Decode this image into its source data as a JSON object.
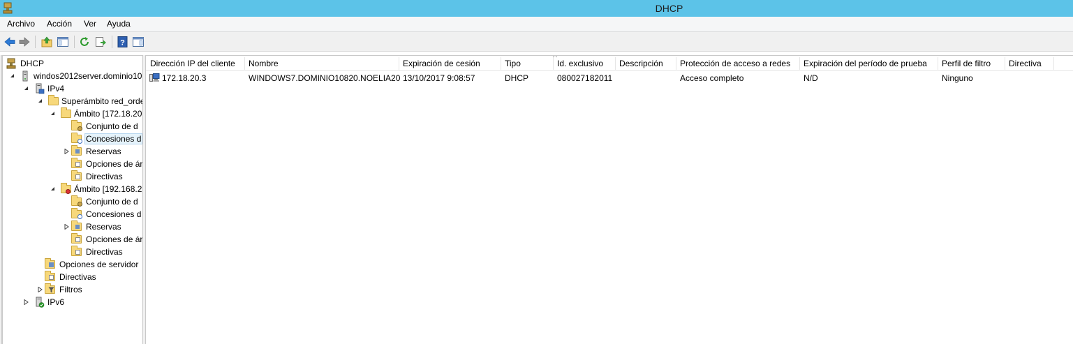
{
  "window": {
    "title": "DHCP",
    "accent": "#5cc3e8"
  },
  "menu": [
    "Archivo",
    "Acción",
    "Ver",
    "Ayuda"
  ],
  "toolbar": {
    "buttons": [
      "back-icon",
      "forward-icon",
      "up-folder-icon",
      "show-hide-tree-icon",
      "refresh-icon",
      "export-list-icon",
      "help-icon",
      "show-action-pane-icon"
    ]
  },
  "tree": {
    "root": "DHCP",
    "server": "windos2012server.dominio10",
    "ipv4": "IPv4",
    "superscope": "Superámbito red_orde",
    "scope1": "Ámbito [172.18.20",
    "scope1_items": [
      "Conjunto de d",
      "Concesiones d",
      "Reservas",
      "Opciones de ár",
      "Directivas"
    ],
    "scope2": "Ámbito [192.168.2",
    "scope2_items": [
      "Conjunto de d",
      "Concesiones d",
      "Reservas",
      "Opciones de ár",
      "Directivas"
    ],
    "server_options": "Opciones de servidor",
    "policies": "Directivas",
    "filters": "Filtros",
    "ipv6": "IPv6"
  },
  "list": {
    "columns": [
      "Dirección IP del cliente",
      "Nombre",
      "Expiración de cesión",
      "Tipo",
      "Id. exclusivo",
      "Descripción",
      "Protección de acceso a redes",
      "Expiración del período de prueba",
      "Perfil de filtro",
      "Directiva"
    ],
    "rows": [
      [
        "172.18.20.3",
        "WINDOWS7.DOMINIO10820.NOELIA20",
        "13/10/2017 9:08:57",
        "DHCP",
        "080027182011",
        "",
        "Acceso completo",
        "N/D",
        "Ninguno",
        ""
      ]
    ]
  }
}
